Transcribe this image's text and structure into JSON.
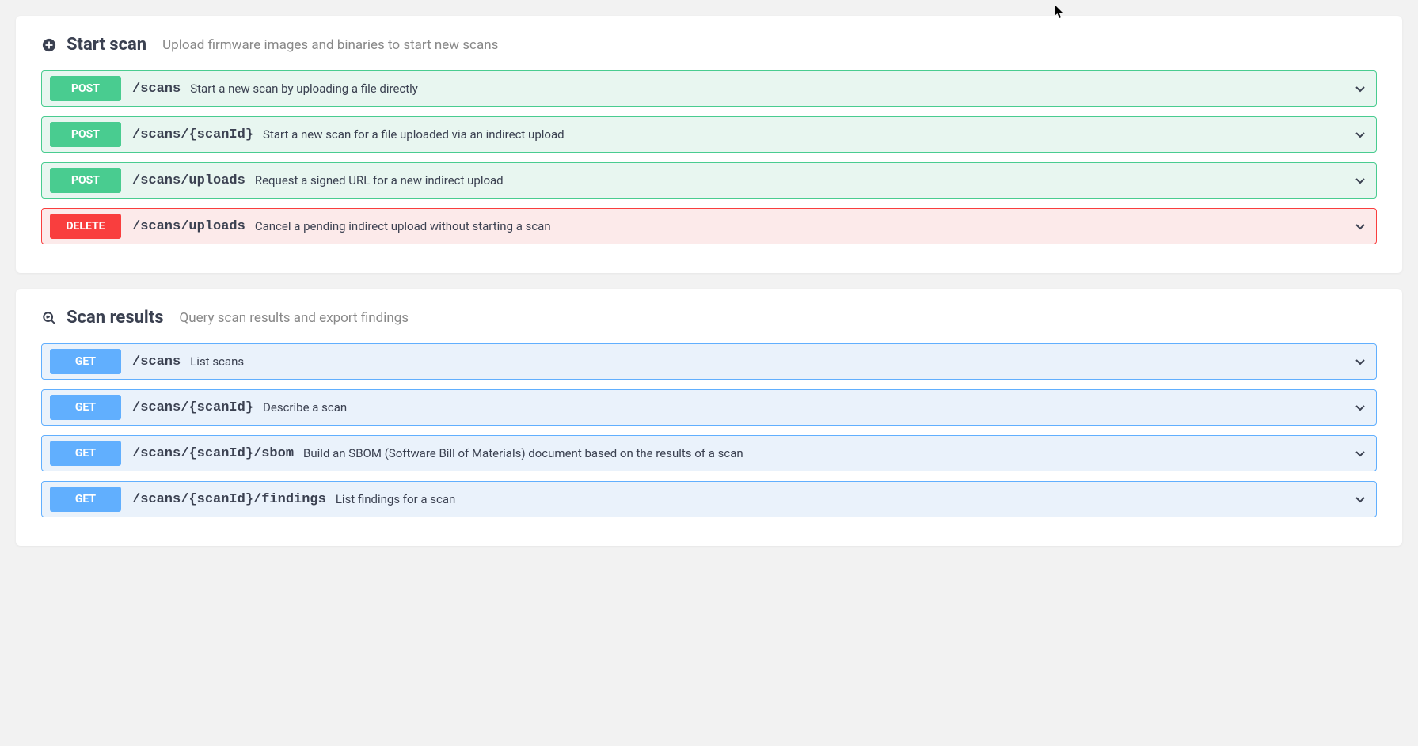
{
  "sections": [
    {
      "title": "Start scan",
      "description": "Upload firmware images and binaries to start new scans",
      "icon": "plus-circle-icon",
      "endpoints": [
        {
          "method": "POST",
          "path": "/scans",
          "description": "Start a new scan by uploading a file directly"
        },
        {
          "method": "POST",
          "path": "/scans/{scanId}",
          "description": "Start a new scan for a file uploaded via an indirect upload"
        },
        {
          "method": "POST",
          "path": "/scans/uploads",
          "description": "Request a signed URL for a new indirect upload"
        },
        {
          "method": "DELETE",
          "path": "/scans/uploads",
          "description": "Cancel a pending indirect upload without starting a scan"
        }
      ]
    },
    {
      "title": "Scan results",
      "description": "Query scan results and export findings",
      "icon": "magnify-icon",
      "endpoints": [
        {
          "method": "GET",
          "path": "/scans",
          "description": "List scans"
        },
        {
          "method": "GET",
          "path": "/scans/{scanId}",
          "description": "Describe a scan"
        },
        {
          "method": "GET",
          "path": "/scans/{scanId}/sbom",
          "description": "Build an SBOM (Software Bill of Materials) document based on the results of a scan"
        },
        {
          "method": "GET",
          "path": "/scans/{scanId}/findings",
          "description": "List findings for a scan"
        }
      ]
    }
  ]
}
